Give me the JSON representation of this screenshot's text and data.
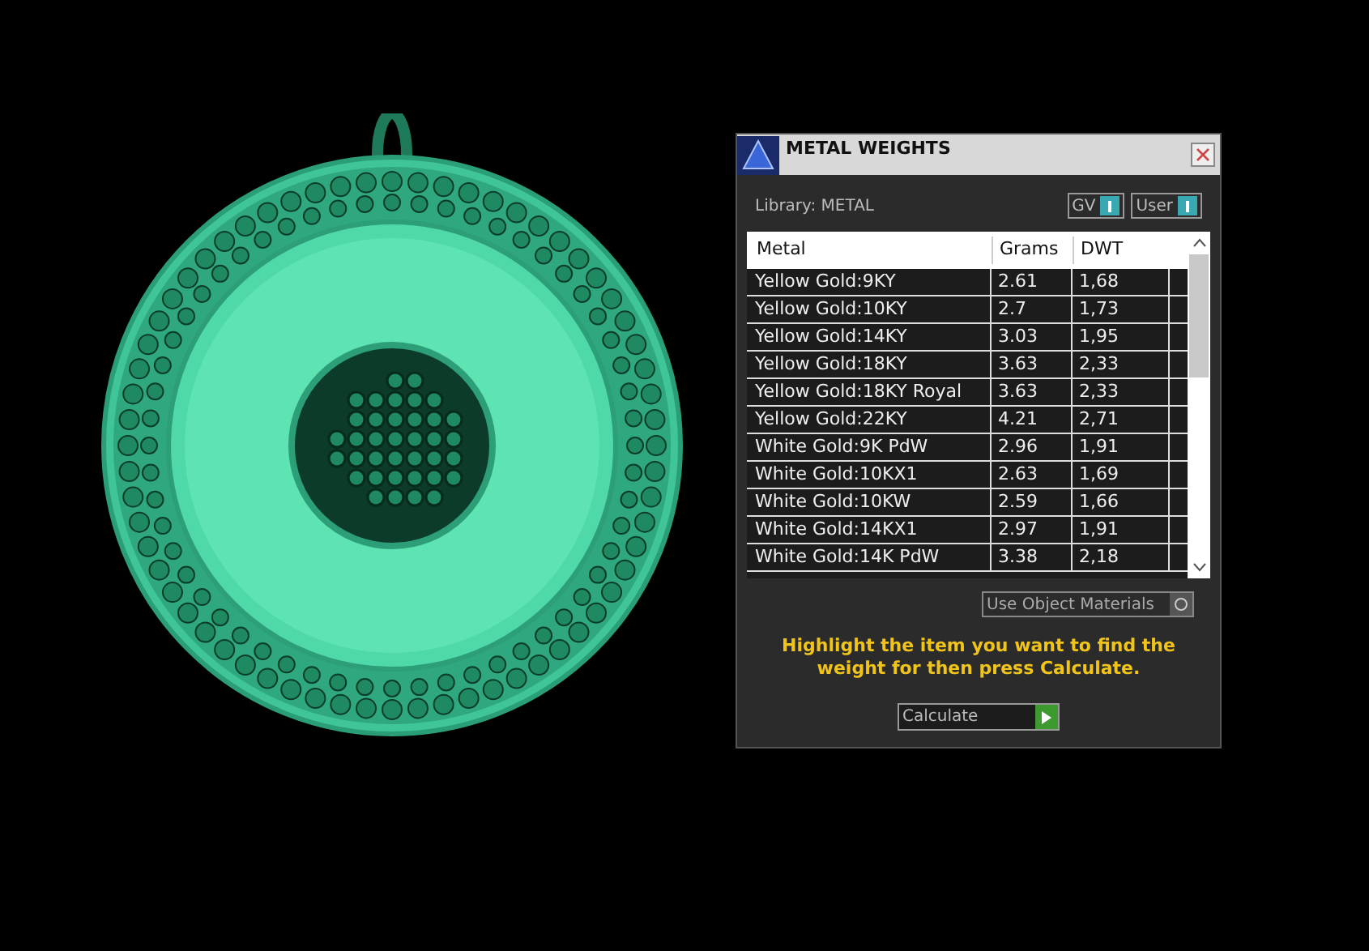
{
  "window": {
    "title": "METAL WEIGHTS"
  },
  "library": "Library: METAL",
  "toggles": [
    {
      "label": "GV"
    },
    {
      "label": "User"
    }
  ],
  "table": {
    "columns": [
      "Metal",
      "Grams",
      "DWT"
    ],
    "rows": [
      {
        "metal": "Yellow Gold:9KY",
        "grams": "2.61",
        "dwt": "1,68",
        "selected": false
      },
      {
        "metal": "Yellow Gold:10KY",
        "grams": "2.7",
        "dwt": "1,73",
        "selected": false
      },
      {
        "metal": "Yellow Gold:14KY",
        "grams": "3.03",
        "dwt": "1,95",
        "selected": false
      },
      {
        "metal": "Yellow Gold:18KY",
        "grams": "3.63",
        "dwt": "2,33",
        "selected": false
      },
      {
        "metal": "Yellow Gold:18KY Royal",
        "grams": "3.63",
        "dwt": "2,33",
        "selected": false
      },
      {
        "metal": "Yellow Gold:22KY",
        "grams": "4.21",
        "dwt": "2,71",
        "selected": false
      },
      {
        "metal": "White Gold:9K PdW",
        "grams": "2.96",
        "dwt": "1,91",
        "selected": false
      },
      {
        "metal": "White Gold:10KX1",
        "grams": "2.63",
        "dwt": "1,69",
        "selected": false
      },
      {
        "metal": "White Gold:10KW",
        "grams": "2.59",
        "dwt": "1,66",
        "selected": false
      },
      {
        "metal": "White Gold:14KX1",
        "grams": "2.97",
        "dwt": "1,91",
        "selected": false
      },
      {
        "metal": "White Gold:14K PdW",
        "grams": "3.38",
        "dwt": "2,18",
        "selected": false
      }
    ]
  },
  "use_object_materials": {
    "label": "Use Object Materials",
    "checked": false
  },
  "instruction": "Highlight the item you want to find the weight for then press Calculate.",
  "calculate_button": "Calculate"
}
